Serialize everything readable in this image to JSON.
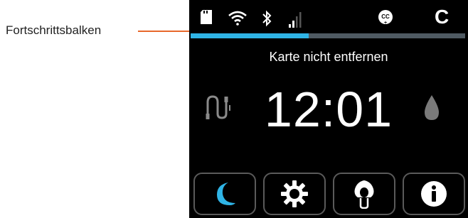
{
  "callout": {
    "label": "Fortschrittsbalken"
  },
  "status_bar": {
    "icons": [
      "sd-card-icon",
      "wifi-icon",
      "bluetooth-icon",
      "signal-icon",
      "cc-icon"
    ],
    "right_letter": "C"
  },
  "progress": {
    "value_percent": 43
  },
  "message": "Karte nicht entfernen",
  "time": "12:01",
  "side_icons": {
    "left": "cable-icon",
    "right": "water-drop-icon"
  },
  "buttons": [
    {
      "name": "night-mode-button",
      "icon": "moon-icon",
      "color": "#2fb4e6"
    },
    {
      "name": "settings-button",
      "icon": "gear-icon",
      "color": "#ffffff"
    },
    {
      "name": "mask-button",
      "icon": "mask-icon",
      "color": "#ffffff"
    },
    {
      "name": "info-button",
      "icon": "info-icon",
      "color": "#ffffff"
    }
  ],
  "colors": {
    "accent": "#2fb4e6",
    "callout_line": "#e8672a",
    "track": "#4f5a62"
  }
}
